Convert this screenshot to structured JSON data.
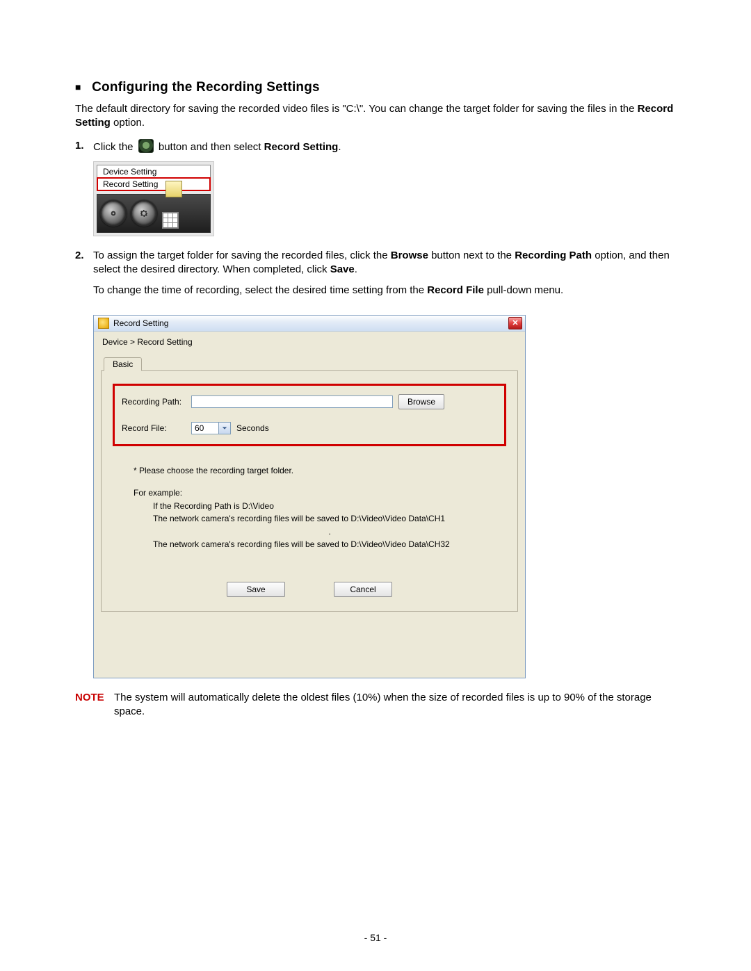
{
  "section": {
    "bullet": "■",
    "title": "Configuring the Recording Settings"
  },
  "intro": {
    "p1a": "The default directory for saving the recorded video files is \"C:\\\". You can change the target folder for saving the files in the ",
    "p1b": "Record Setting",
    "p1c": " option."
  },
  "step1": {
    "num": "1.",
    "a": "Click the ",
    "b": " button and then select ",
    "c": "Record Setting",
    "d": "."
  },
  "mini": {
    "item1": "Device Setting",
    "item2": "Record Setting"
  },
  "step2": {
    "num": "2.",
    "a": "To assign the target folder for saving the recorded files, click the ",
    "b": "Browse",
    "c": " button next to the ",
    "d": "Recording Path",
    "e": " option, and then select the desired directory. When completed, click ",
    "f": "Save",
    "g": ".",
    "p2a": "To change the time of recording, select the desired time setting from the ",
    "p2b": "Record File",
    "p2c": " pull-down menu."
  },
  "win": {
    "title": "Record Setting",
    "close": "✕",
    "breadcrumb": "Device > Record Setting",
    "tab": "Basic",
    "label_path": "Recording Path:",
    "path_value": "",
    "browse": "Browse",
    "label_file": "Record File:",
    "combo_value": "60",
    "seconds": "Seconds",
    "hint1": "* Please choose the recording target folder.",
    "hint2": "For example:",
    "hint3": "If the Recording Path is D:\\Video",
    "hint4": "The network camera's recording files will be saved to D:\\Video\\Video Data\\CH1",
    "hint5": ".",
    "hint6": "The network camera's recording files will be saved to D:\\Video\\Video Data\\CH32",
    "save": "Save",
    "cancel": "Cancel"
  },
  "note": {
    "label": "NOTE",
    "text": "The system will automatically delete the oldest files (10%) when the size of recorded files is up to 90% of the storage space."
  },
  "footer": "- 51 -"
}
